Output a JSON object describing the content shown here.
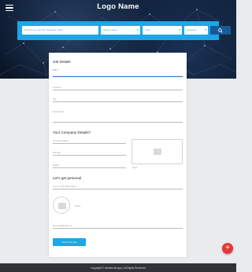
{
  "header": {
    "logo": "Logo Name"
  },
  "search": {
    "keyword_placeholder": "Keyword (e.g. Job Title, Description, Tags)",
    "location_placeholder": "Select Location",
    "type_placeholder": "Types",
    "category_placeholder": "Categories"
  },
  "form": {
    "job_details": {
      "title": "Job Details",
      "fields": {
        "title": "Title *",
        "location": "Location",
        "city": "City",
        "description": "Description"
      }
    },
    "company": {
      "title": "Your Company Details?",
      "fields": {
        "name": "Company Name",
        "website": "Website",
        "twitter": "Twitter"
      },
      "logo_label": "Logo"
    },
    "personal": {
      "title": "Let's get personal",
      "fields": {
        "your_name": "Your or Your Boss Name"
      },
      "photo_label": "Photo",
      "email_field": "Email application to"
    },
    "submit_label": "Post Your Job"
  },
  "footer": {
    "copyright": "Copyright © website.abcxyz | All Rights Reserved"
  },
  "fab": {
    "label": "+"
  }
}
